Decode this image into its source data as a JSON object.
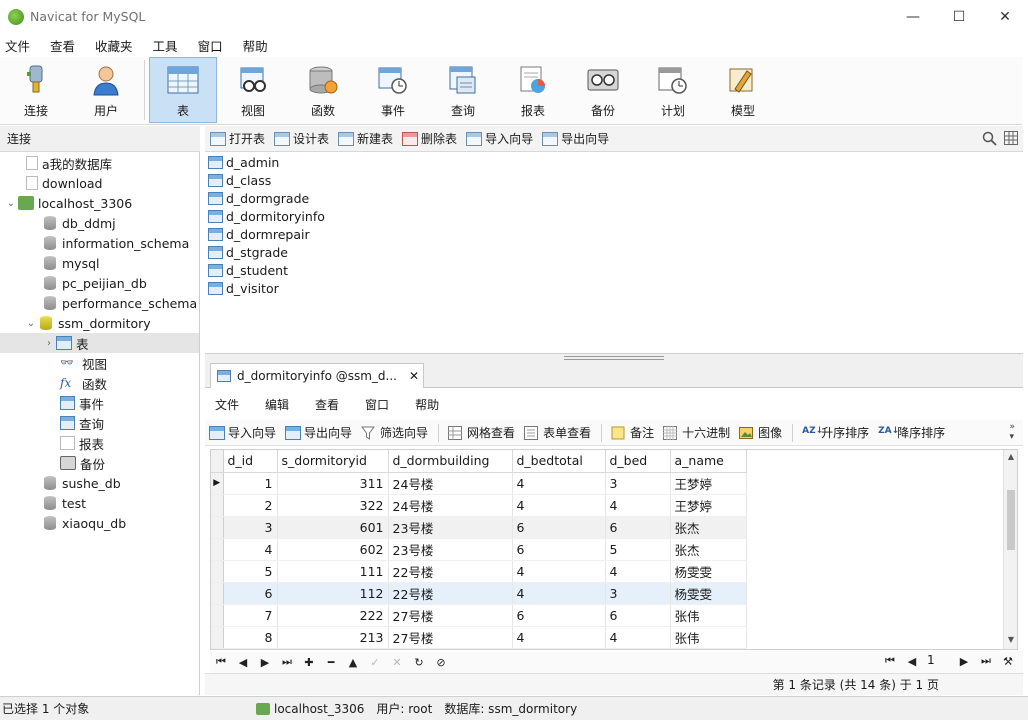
{
  "window": {
    "title": "Navicat for MySQL",
    "minimize": "—",
    "maximize": "☐",
    "close": "✕"
  },
  "menu": [
    "文件",
    "查看",
    "收藏夹",
    "工具",
    "窗口",
    "帮助"
  ],
  "toolbar": {
    "connect": "连接",
    "user": "用户",
    "table": "表",
    "view": "视图",
    "function": "函数",
    "event": "事件",
    "query": "查询",
    "report": "报表",
    "backup": "备份",
    "schedule": "计划",
    "model": "模型"
  },
  "sidebar": {
    "header": "连接",
    "items": [
      "a我的数据库",
      "download",
      "localhost_3306",
      "db_ddmj",
      "information_schema",
      "mysql",
      "pc_peijian_db",
      "performance_schema",
      "ssm_dormitory",
      "表",
      "视图",
      "函数",
      "事件",
      "查询",
      "报表",
      "备份",
      "sushe_db",
      "test",
      "xiaoqu_db"
    ]
  },
  "object_toolbar": {
    "open": "打开表",
    "design": "设计表",
    "new": "新建表",
    "delete": "删除表",
    "import": "导入向导",
    "export": "导出向导"
  },
  "objects": [
    "d_admin",
    "d_class",
    "d_dormgrade",
    "d_dormitoryinfo",
    "d_dormrepair",
    "d_stgrade",
    "d_student",
    "d_visitor"
  ],
  "tab": {
    "label": "d_dormitoryinfo @ssm_d...",
    "close": "✕"
  },
  "inner_menu": [
    "文件",
    "编辑",
    "查看",
    "窗口",
    "帮助"
  ],
  "inner_toolbar": {
    "import": "导入向导",
    "export": "导出向导",
    "filter": "筛选向导",
    "grid_view": "网格查看",
    "form_view": "表单查看",
    "memo": "备注",
    "hex": "十六进制",
    "image": "图像",
    "sort_asc": "升序排序",
    "sort_desc": "降序排序"
  },
  "grid": {
    "columns": [
      "d_id",
      "s_dormitoryid",
      "d_dormbuilding",
      "d_bedtotal",
      "d_bed",
      "a_name"
    ],
    "rows": [
      [
        "1",
        "311",
        "24号楼",
        "4",
        "3",
        "王梦婷"
      ],
      [
        "2",
        "322",
        "24号楼",
        "4",
        "4",
        "王梦婷"
      ],
      [
        "3",
        "601",
        "23号楼",
        "6",
        "6",
        "张杰"
      ],
      [
        "4",
        "602",
        "23号楼",
        "6",
        "5",
        "张杰"
      ],
      [
        "5",
        "111",
        "22号楼",
        "4",
        "4",
        "杨雯雯"
      ],
      [
        "6",
        "112",
        "22号楼",
        "4",
        "3",
        "杨雯雯"
      ],
      [
        "7",
        "222",
        "27号楼",
        "6",
        "6",
        "张伟"
      ],
      [
        "8",
        "213",
        "27号楼",
        "4",
        "4",
        "张伟"
      ]
    ]
  },
  "pager": {
    "page": "1"
  },
  "record_status": "第 1 条记录 (共 14 条) 于 1 页",
  "status": {
    "selected": "已选择 1 个对象",
    "connection": "localhost_3306",
    "user": "用户: root",
    "database": "数据库: ssm_dormitory"
  }
}
